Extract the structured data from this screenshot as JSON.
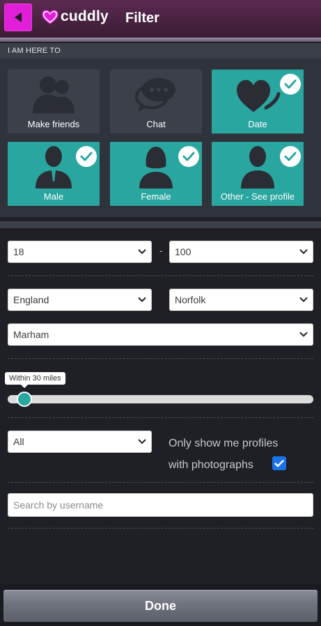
{
  "header": {
    "logo_text": "cuddly",
    "title": "Filter",
    "back_icon": "back-arrow-icon"
  },
  "purpose": {
    "section_label": "I AM HERE TO",
    "options": [
      {
        "label": "Make friends",
        "icon": "friends-icon",
        "selected": false
      },
      {
        "label": "Chat",
        "icon": "chat-bubbles-icon",
        "selected": false
      },
      {
        "label": "Date",
        "icon": "hearts-icon",
        "selected": true
      },
      {
        "label": "Male",
        "icon": "male-person-icon",
        "selected": true
      },
      {
        "label": "Female",
        "icon": "female-person-icon",
        "selected": true
      },
      {
        "label": "Other - See profile",
        "icon": "person-icon",
        "selected": true
      }
    ]
  },
  "age": {
    "min": "18",
    "separator": "-",
    "max": "100"
  },
  "location": {
    "country": "England",
    "county": "Norfolk",
    "town": "Marham"
  },
  "distance": {
    "tooltip": "Within 30 miles",
    "value": 30
  },
  "profile_filter": {
    "select_value": "All",
    "photos_text_line1": "Only show me profiles",
    "photos_text_line2": "with photographs",
    "photos_checked": true
  },
  "search": {
    "placeholder": "Search by username",
    "value": ""
  },
  "footer": {
    "done_label": "Done"
  },
  "colors": {
    "accent": "#2aa6a1",
    "back_button": "#e21fd8",
    "header": "#47213f",
    "checkbox": "#1a73e8"
  }
}
